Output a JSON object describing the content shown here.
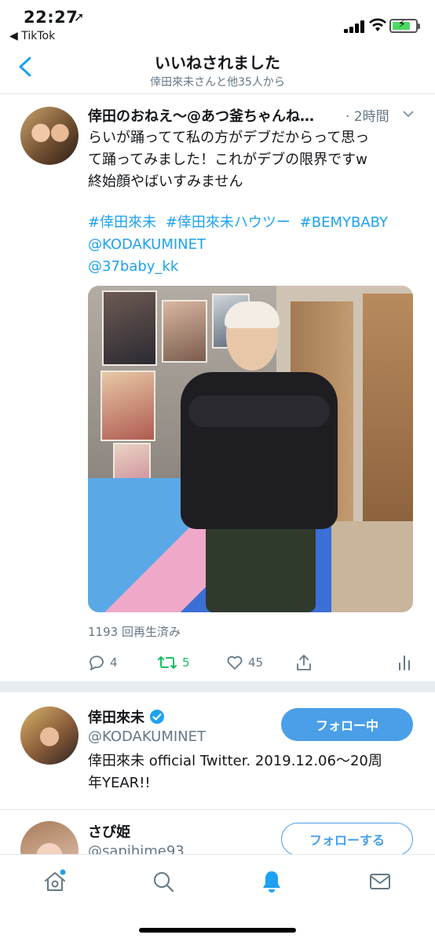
{
  "status_bar": {
    "time": "22:27",
    "back_app": "◀ TikTok",
    "battery_color": "#4cd964"
  },
  "header": {
    "title": "いいねされました",
    "subtitle": "倖田來未さんと他35人から",
    "accent": "#1da1f2"
  },
  "tweet": {
    "author": "倖田のおねえ〜@あつ釜ちゃんね…",
    "time": "· 2時間",
    "text_lines": [
      "らいが踊ってて私の方がデブだからって思っ",
      "て踊ってみました！これがデブの限界ですw",
      "終始顔やばいすみません"
    ],
    "hashtags": [
      "#倖田來未",
      "#倖田來未ハウツー",
      "#BEMYBABY"
    ],
    "mentions": [
      "@KODAKUMINET",
      "@37baby_kk"
    ],
    "views": "1193 回再生済み",
    "replies": "4",
    "retweets": "5",
    "likes": "45"
  },
  "users": [
    {
      "name": "倖田來未",
      "verified": true,
      "handle": "@KODAKUMINET",
      "bio_lines": [
        "倖田來未 official Twitter. 2019.12.06〜20周",
        "年YEAR!!"
      ],
      "button": "フォロー中"
    },
    {
      "name": "さぴ姫",
      "handle": "@sapihime93",
      "button": "フォローする"
    }
  ],
  "tabbar": {
    "icons": [
      "home-icon",
      "search-icon",
      "notifications-icon",
      "messages-icon"
    ],
    "active": "notifications-icon"
  }
}
